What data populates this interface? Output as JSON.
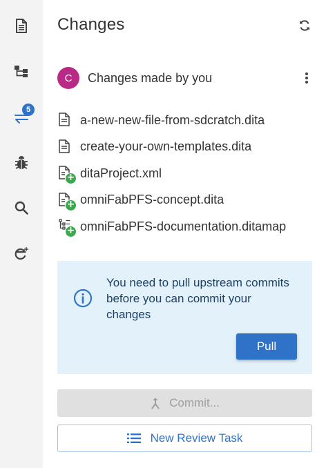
{
  "activity_bar": {
    "items": [
      {
        "icon": "files-icon"
      },
      {
        "icon": "outline-icon"
      },
      {
        "icon": "changes-icon",
        "badge": "5",
        "active_color": "#2f73c9"
      },
      {
        "icon": "bug-icon"
      },
      {
        "icon": "search-icon"
      },
      {
        "icon": "extensions-icon"
      }
    ]
  },
  "panel": {
    "title": "Changes",
    "refresh_icon": "refresh-icon"
  },
  "section": {
    "avatar_letter": "C",
    "avatar_color": "#b92a86",
    "title": "Changes made by you",
    "more_icon": "more-vertical-icon"
  },
  "files": [
    {
      "name": "a-new-new-file-from-sdcratch.dita",
      "icon": "document-icon",
      "added": false
    },
    {
      "name": "create-your-own-templates.dita",
      "icon": "document-icon",
      "added": false
    },
    {
      "name": "ditaProject.xml",
      "icon": "document-icon",
      "added": true
    },
    {
      "name": "omniFabPFS-concept.dita",
      "icon": "document-icon",
      "added": true
    },
    {
      "name": "omniFabPFS-documentation.ditamap",
      "icon": "map-icon",
      "added": true
    }
  ],
  "notice": {
    "icon": "info-icon",
    "text": "You need to pull upstream commits before you can commit your changes",
    "pull_label": "Pull"
  },
  "commit": {
    "label": "Commit...",
    "icon": "merge-icon"
  },
  "review": {
    "label": "New Review Task",
    "icon": "list-icon"
  },
  "colors": {
    "accent": "#2f73c9",
    "added": "#3aa84c",
    "notice_bg": "#e3f2fa"
  }
}
